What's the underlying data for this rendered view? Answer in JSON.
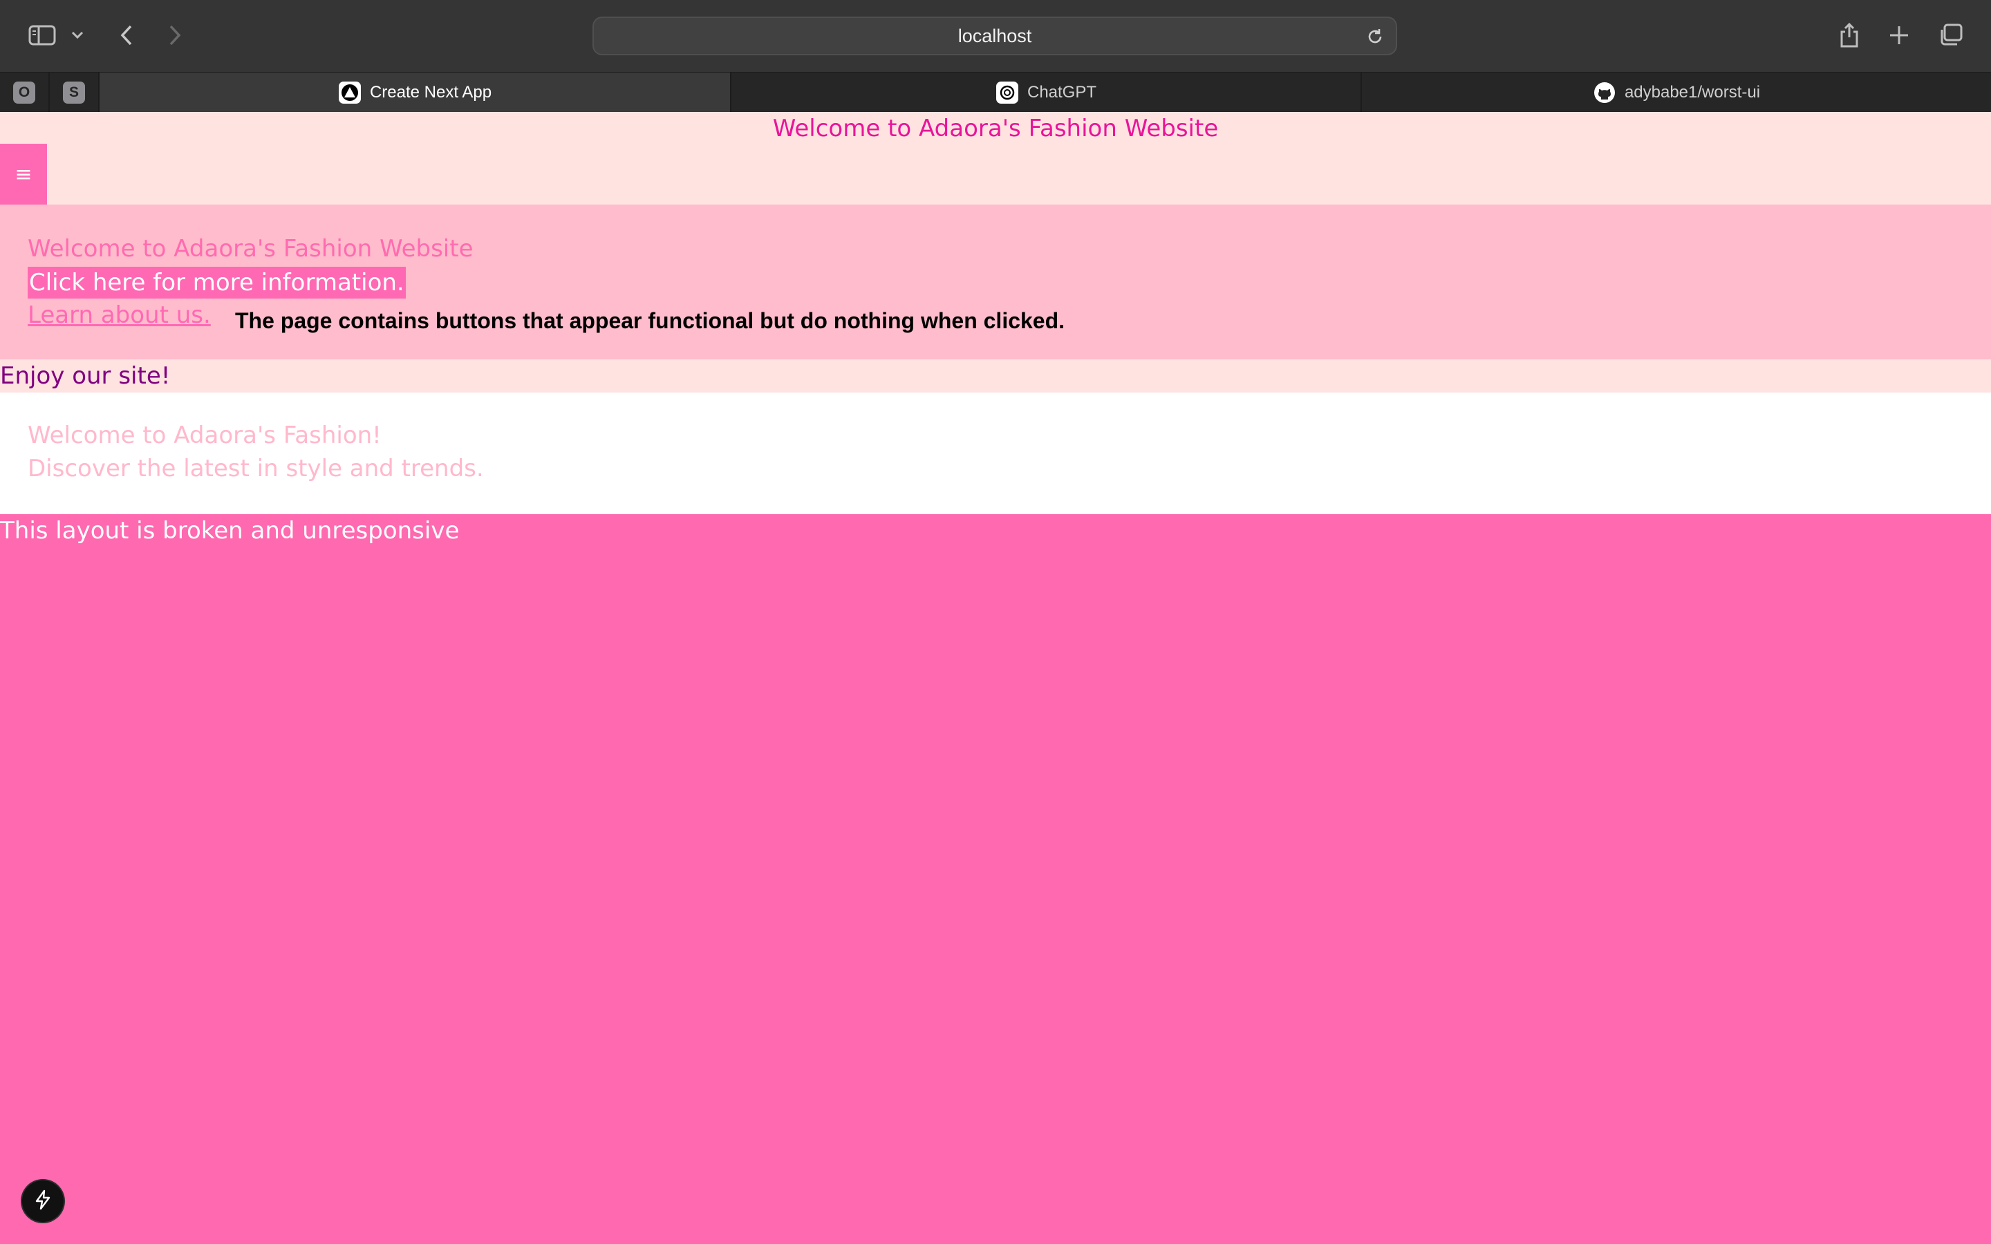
{
  "browser": {
    "url": "localhost",
    "pinned_tabs": [
      {
        "label": "O"
      },
      {
        "label": "S"
      }
    ],
    "tabs": [
      {
        "title": "Create Next App",
        "icon": "nextjs-icon",
        "active": true
      },
      {
        "title": "ChatGPT",
        "icon": "chatgpt-icon",
        "active": false
      },
      {
        "title": "adybabe1/worst-ui",
        "icon": "github-icon",
        "active": false
      }
    ]
  },
  "header": {
    "title": "Welcome to Adaora's Fashion Website",
    "menu_icon": "≡"
  },
  "hero": {
    "title": "Welcome to Adaora's Fashion Website",
    "cta_label": "Click here for more information.",
    "link_label": "Learn about us.",
    "note": "The page contains buttons that appear functional but do nothing when clicked."
  },
  "banner": {
    "text": "Enjoy our site!"
  },
  "intro": {
    "heading": "Welcome to Adaora's Fashion!",
    "subheading": "Discover the latest in style and trends."
  },
  "footer_note": "This layout is broken and unresponsive",
  "colors": {
    "page_background": "#ff69b0",
    "header_background": "#ffe3e1",
    "hero_background": "#ffbccc",
    "accent_pink": "#ff69b4",
    "title_magenta": "#e8159a",
    "banner_text": "#800080"
  }
}
